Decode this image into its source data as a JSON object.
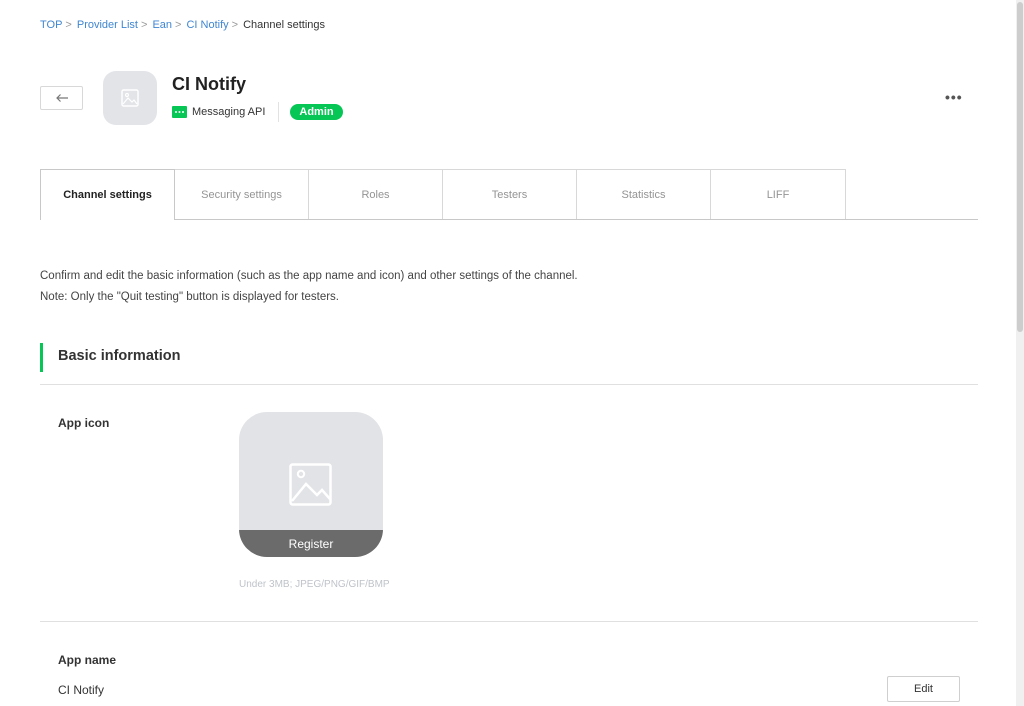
{
  "breadcrumb": {
    "items": [
      "TOP",
      "Provider List",
      "Ean",
      "CI Notify"
    ],
    "current": "Channel settings",
    "separator": ">"
  },
  "channel": {
    "name": "CI Notify",
    "type": "Messaging API",
    "role_badge": "Admin",
    "more_label": "•••"
  },
  "tabs": [
    {
      "label": "Channel settings",
      "active": true
    },
    {
      "label": "Security settings",
      "active": false
    },
    {
      "label": "Roles",
      "active": false
    },
    {
      "label": "Testers",
      "active": false
    },
    {
      "label": "Statistics",
      "active": false
    },
    {
      "label": "LIFF",
      "active": false
    }
  ],
  "intro": {
    "line1": "Confirm and edit the basic information (such as the app name and icon) and other settings of the channel.",
    "line2": "Note: Only the \"Quit testing\" button is displayed for testers."
  },
  "basic_info": {
    "title": "Basic information",
    "app_icon": {
      "label": "App icon",
      "register_label": "Register",
      "hint": "Under 3MB; JPEG/PNG/GIF/BMP"
    },
    "app_name": {
      "label": "App name",
      "value": "CI Notify",
      "edit_label": "Edit"
    }
  },
  "icons": {
    "back": "arrow-left-icon",
    "channel_avatar": "image-placeholder-icon",
    "messaging_api": "chat-bubble-icon",
    "app_icon": "image-placeholder-icon"
  },
  "colors": {
    "accent_green": "#06c755",
    "link_blue": "#3f86d1"
  }
}
